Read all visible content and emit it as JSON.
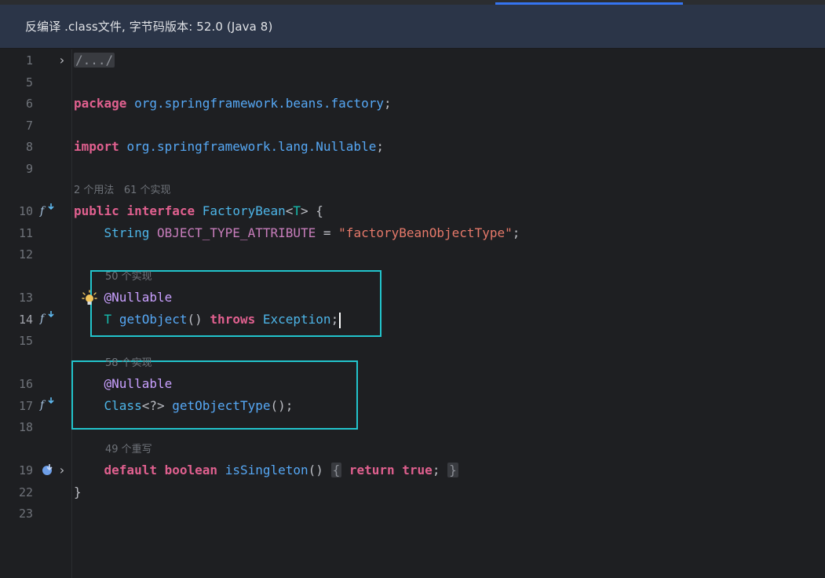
{
  "banner": {
    "text": "反编译 .class文件, 字节码版本: 52.0 (Java 8)"
  },
  "colors": {
    "highlight_box": "#22c4cc",
    "banner_bg": "#2b3548",
    "editor_bg": "#1e1f22"
  },
  "lines": [
    {
      "num": "1",
      "fold": "/.../"
    },
    {
      "num": "5"
    },
    {
      "num": "6",
      "kw": "package",
      "pkg": "org.springframework.beans.factory",
      "end": ";"
    },
    {
      "num": "7"
    },
    {
      "num": "8",
      "kw": "import",
      "pkg": "org.springframework.lang.",
      "cls": "Nullable",
      "end": ";"
    },
    {
      "num": "9"
    },
    {
      "num": "10",
      "hint_usages": "2 个用法",
      "hint_impls": "61 个实现",
      "kw1": "public",
      "kw2": "interface",
      "name": "FactoryBean",
      "lt": "<",
      "tp": "T",
      "gt": "> {"
    },
    {
      "num": "11",
      "type": "String",
      "field": "OBJECT_TYPE_ATTRIBUTE",
      "eq": " = ",
      "str": "\"factoryBeanObjectType\"",
      "end": ";"
    },
    {
      "num": "12"
    },
    {
      "num": "13",
      "hint": "50 个实现",
      "ann": "@Nullable"
    },
    {
      "num": "14",
      "tp": "T",
      "fn": "getObject",
      "paren": "() ",
      "kw": "throws",
      "exc": "Exception",
      "end": ";"
    },
    {
      "num": "15"
    },
    {
      "num": "16",
      "hint": "58 个实现",
      "ann": "@Nullable"
    },
    {
      "num": "17",
      "type": "Class",
      "gen": "<?>",
      "fn": "getObjectType",
      "end": "();"
    },
    {
      "num": "18"
    },
    {
      "num": "19",
      "hint": "49 个重写",
      "kw1": "default",
      "kw2": "boolean",
      "fn": "isSingleton",
      "paren": "()",
      "fold_open": "{",
      "kw3": "return",
      "kw4": "true",
      "semi": ";",
      "fold_close": "}"
    },
    {
      "num": "22",
      "brace": "}"
    },
    {
      "num": "23"
    }
  ],
  "gutter_icons": {
    "implemented": "f-implemented-icon",
    "overridden": "override-icon",
    "intention": "lightbulb-icon",
    "fold": "chevron-right-icon"
  }
}
